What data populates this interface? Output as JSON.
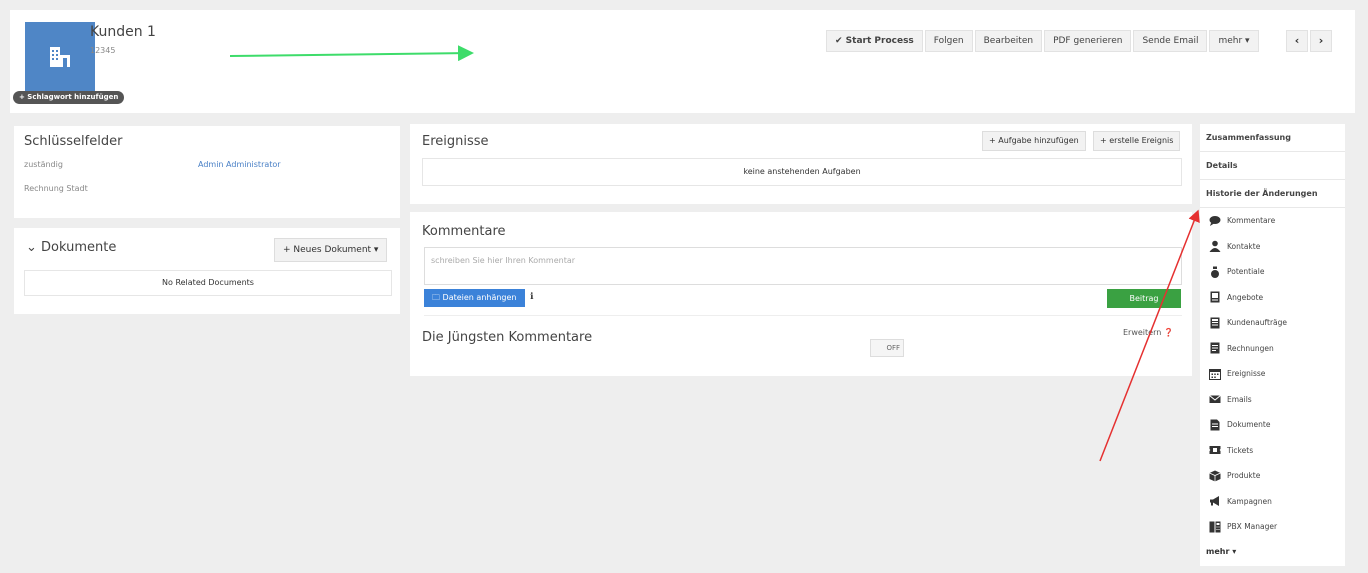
{
  "header": {
    "name": "Kunden 1",
    "id": "12345",
    "tag_button": "+ Schlagwort hinzufügen",
    "actions": [
      "✔ Start Process",
      "Folgen",
      "Bearbeiten",
      "PDF generieren",
      "Sende Email",
      "mehr ▾"
    ],
    "prev": "‹",
    "next": "›",
    "accent": "#4f86c6"
  },
  "keyfields": {
    "title": "Schlüsselfelder",
    "rows": [
      {
        "label": "zuständig",
        "value": "Admin Administrator"
      },
      {
        "label": "Rechnung Stadt",
        "value": ""
      }
    ]
  },
  "documents": {
    "title": "⌄ Dokumente",
    "new_button": "+ Neues Dokument ▾",
    "empty": "No Related Documents"
  },
  "events": {
    "title": "Ereignisse",
    "add_task": "+ Aufgabe hinzufügen",
    "create_event": "+ erstelle Ereignis",
    "empty": "keine anstehenden Aufgaben"
  },
  "comments": {
    "title": "Kommentare",
    "placeholder": "schreiben Sie hier Ihren Kommentar",
    "attach": "🗀 Dateien anhängen",
    "info": "ℹ",
    "submit": "Beitrag",
    "latest_title": "Die Jüngsten Kommentare",
    "expand": "Erweitern ❓",
    "toggle": "OFF",
    "submit_color": "#3aa142",
    "attach_color": "#3b82d9"
  },
  "sidebar": {
    "tabs": [
      "Zusammenfassung",
      "Details",
      "Historie der Änderungen"
    ],
    "items": [
      {
        "label": "Kommentare",
        "icon": "comment-icon"
      },
      {
        "label": "Kontakte",
        "icon": "user-icon"
      },
      {
        "label": "Potentiale",
        "icon": "money-bag-icon"
      },
      {
        "label": "Angebote",
        "icon": "quote-icon"
      },
      {
        "label": "Kundenaufträge",
        "icon": "order-icon"
      },
      {
        "label": "Rechnungen",
        "icon": "invoice-icon"
      },
      {
        "label": "Ereignisse",
        "icon": "calendar-icon"
      },
      {
        "label": "Emails",
        "icon": "email-icon"
      },
      {
        "label": "Dokumente",
        "icon": "document-icon"
      },
      {
        "label": "Tickets",
        "icon": "ticket-icon"
      },
      {
        "label": "Produkte",
        "icon": "product-icon"
      },
      {
        "label": "Kampagnen",
        "icon": "megaphone-icon"
      },
      {
        "label": "PBX Manager",
        "icon": "pbx-icon"
      }
    ],
    "more": "mehr ▾"
  },
  "annotations": {
    "green_arrow_color": "#3ddc6a",
    "red_arrow_color": "#e53030"
  }
}
